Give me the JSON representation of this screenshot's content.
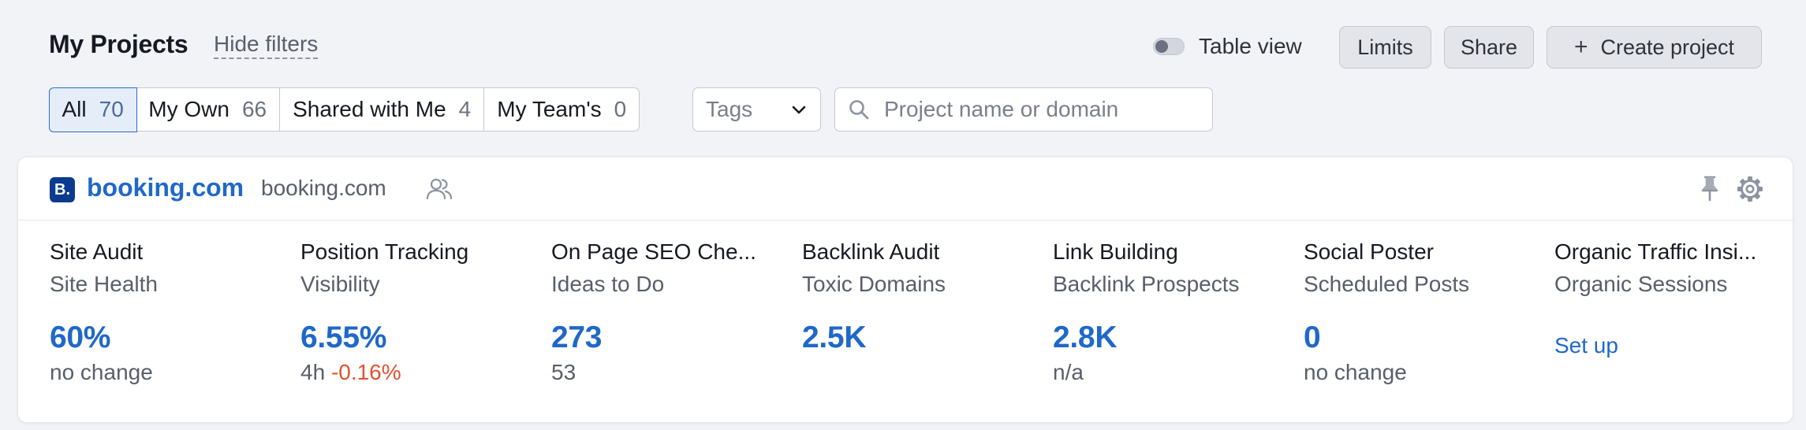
{
  "header": {
    "title": "My Projects",
    "hide_filters": "Hide filters",
    "table_view_label": "Table view",
    "limits_label": "Limits",
    "share_label": "Share",
    "create_label": "Create project"
  },
  "filters": {
    "tabs": [
      {
        "label": "All",
        "count": "70"
      },
      {
        "label": "My Own",
        "count": "66"
      },
      {
        "label": "Shared with Me",
        "count": "4"
      },
      {
        "label": "My Team's",
        "count": "0"
      }
    ],
    "tags_label": "Tags",
    "search_placeholder": "Project name or domain"
  },
  "project": {
    "logo_letter": "B.",
    "name": "booking.com",
    "domain": "booking.com",
    "tools": [
      {
        "name": "Site Audit",
        "metric": "Site Health",
        "value": "60%",
        "sub": "no change"
      },
      {
        "name": "Position Tracking",
        "metric": "Visibility",
        "value": "6.55%",
        "sub_prefix": "4h",
        "sub_delta": "-0.16%"
      },
      {
        "name": "On Page SEO Che...",
        "metric": "Ideas to Do",
        "value": "273",
        "sub": "53"
      },
      {
        "name": "Backlink Audit",
        "metric": "Toxic Domains",
        "value": "2.5K",
        "sub": ""
      },
      {
        "name": "Link Building",
        "metric": "Backlink Prospects",
        "value": "2.8K",
        "sub": "n/a"
      },
      {
        "name": "Social Poster",
        "metric": "Scheduled Posts",
        "value": "0",
        "sub": "no change"
      },
      {
        "name": "Organic Traffic Insi...",
        "metric": "Organic Sessions",
        "link": "Set up"
      }
    ]
  },
  "colors": {
    "accent": "#1f68c9",
    "negative": "#e0532e",
    "brand_logo": "#0b3b8f"
  }
}
